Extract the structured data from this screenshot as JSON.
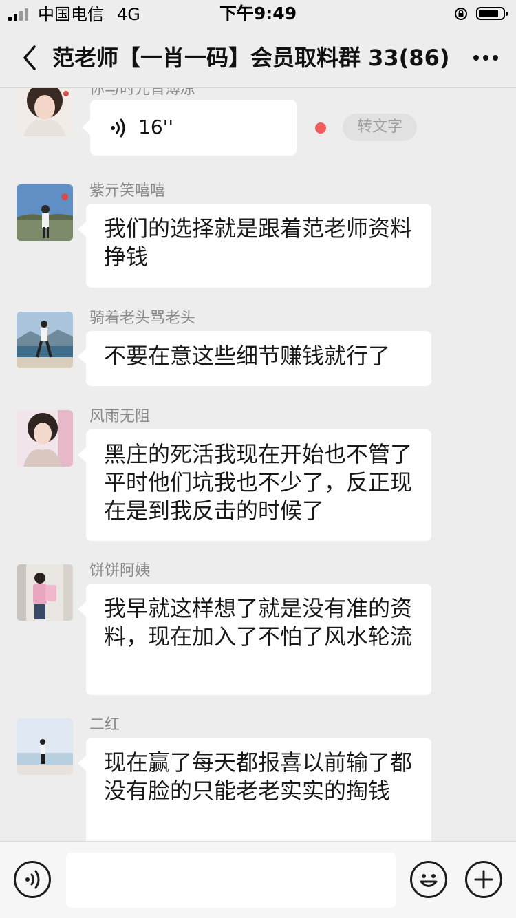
{
  "status_bar": {
    "carrier": "中国电信",
    "network": "4G",
    "time": "下午9:49"
  },
  "nav": {
    "title": "范老师【一肖一码】会员取料群 33(86)",
    "back_icon": "chevron-left-icon",
    "more_icon": "ellipsis-icon"
  },
  "messages": [
    {
      "type": "voice",
      "sender": "你与时光皆薄凉",
      "duration": "16''",
      "to_text_label": "转文字",
      "unread": true
    },
    {
      "type": "text",
      "sender": "紫亓笑嘻嘻",
      "text": "我们的选择就是跟着范老师资料挣钱"
    },
    {
      "type": "text",
      "sender": "骑着老头骂老头",
      "text": "不要在意这些细节赚钱就行了"
    },
    {
      "type": "text",
      "sender": "风雨无阻",
      "text": "黑庄的死活我现在开始也不管了平时他们坑我也不少了，反正现在是到我反击的时候了"
    },
    {
      "type": "text",
      "sender": "饼饼阿姨",
      "text": "我早就这样想了就是没有准的资料，现在加入了不怕了风水轮流"
    },
    {
      "type": "text",
      "sender": "二红",
      "text": "现在赢了每天都报喜以前输了都没有脸的只能老老实实的掏钱"
    }
  ],
  "input_bar": {
    "voice_icon": "voice-input-icon",
    "emoji_icon": "emoji-icon",
    "plus_icon": "plus-icon",
    "text_value": ""
  },
  "colors": {
    "background": "#ededed",
    "bubble": "#ffffff",
    "name": "#8a8a8a",
    "unread_dot": "#f15b5b"
  }
}
